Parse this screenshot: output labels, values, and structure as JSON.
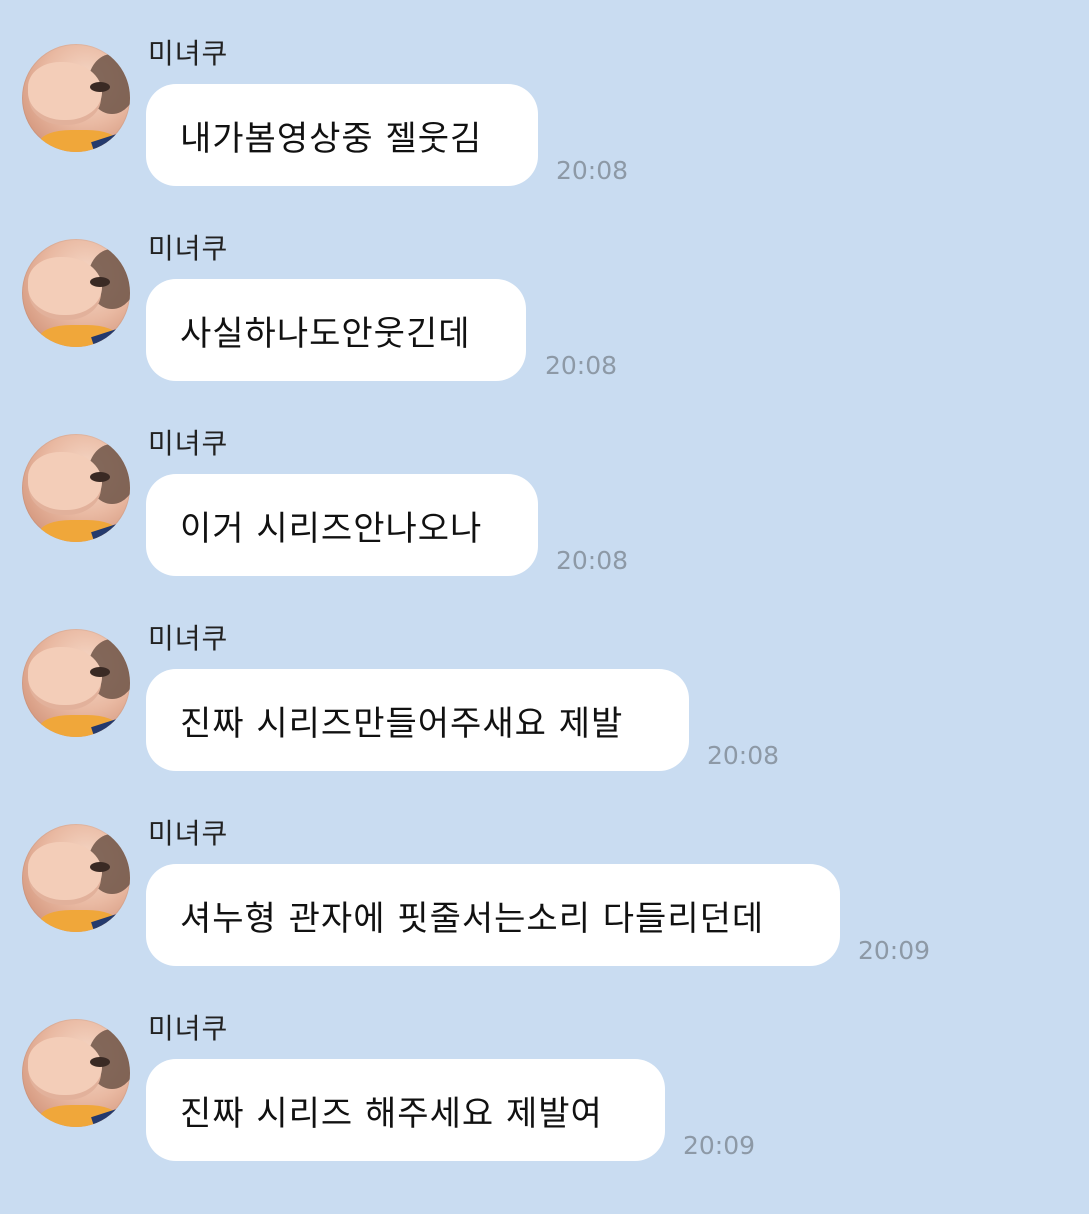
{
  "messages": [
    {
      "sender": "미녀쿠",
      "text": "내가봄영상중 젤웃김",
      "time": "20:08"
    },
    {
      "sender": "미녀쿠",
      "text": "사실하나도안웃긴데",
      "time": "20:08"
    },
    {
      "sender": "미녀쿠",
      "text": "이거 시리즈안나오나",
      "time": "20:08"
    },
    {
      "sender": "미녀쿠",
      "text": "진짜 시리즈만들어주새요 제발",
      "time": "20:08"
    },
    {
      "sender": "미녀쿠",
      "text": "셔누형 관자에 핏줄서는소리 다들리던데",
      "time": "20:09"
    },
    {
      "sender": "미녀쿠",
      "text": "진짜 시리즈 해주세요 제발여",
      "time": "20:09"
    }
  ]
}
